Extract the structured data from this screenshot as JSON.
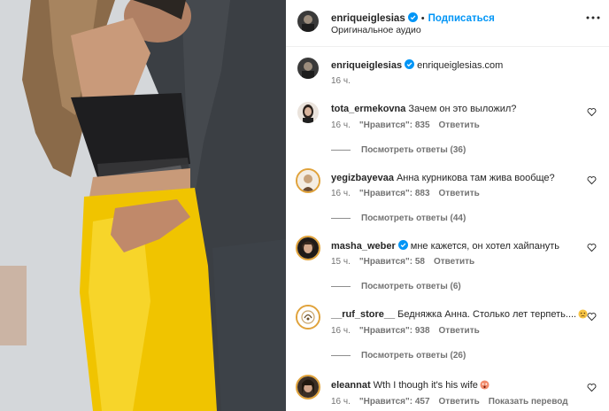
{
  "post": {
    "author": "enriqueiglesias",
    "follow_label": "Подписаться",
    "audio_label": "Оригинальное аудио",
    "caption_author": "enriqueiglesias",
    "caption_text": "enriqueiglesias.com",
    "caption_time": "16 ч."
  },
  "labels": {
    "likes_prefix": "\"Нравится\": ",
    "reply": "Ответить",
    "translate": "Показать перевод"
  },
  "comments": [
    {
      "username": "tota_ermekovna",
      "text": "Зачем он это выложил?",
      "time": "16 ч.",
      "likes": "835",
      "replies": "Посмотреть ответы (36)"
    },
    {
      "username": "yegizbayevaa",
      "text": "Анна курникова там жива вообще?",
      "time": "16 ч.",
      "likes": "883",
      "replies": "Посмотреть ответы (44)"
    },
    {
      "username": "masha_weber",
      "text": "мне кажется, он хотел хайпануть",
      "time": "15 ч.",
      "likes": "58",
      "replies": "Посмотреть ответы (6)"
    },
    {
      "username": "__ruf_store__",
      "text": "Бедняжка Анна. Столько лет терпеть....",
      "time": "16 ч.",
      "likes": "938",
      "replies": "Посмотреть ответы (26)"
    },
    {
      "username": "eleannat",
      "text": "Wth I though it's his wife",
      "time": "16 ч.",
      "likes": "457"
    }
  ],
  "colors": {
    "accent": "#0095f6",
    "verified": "#0095f6",
    "secondary_text": "#737373",
    "yellow_skirt": "#f0c400"
  },
  "icons": [
    "verified-badge-icon",
    "more-options-icon",
    "heart-icon",
    "sad-face-emoji-icon",
    "wow-face-emoji-icon"
  ]
}
